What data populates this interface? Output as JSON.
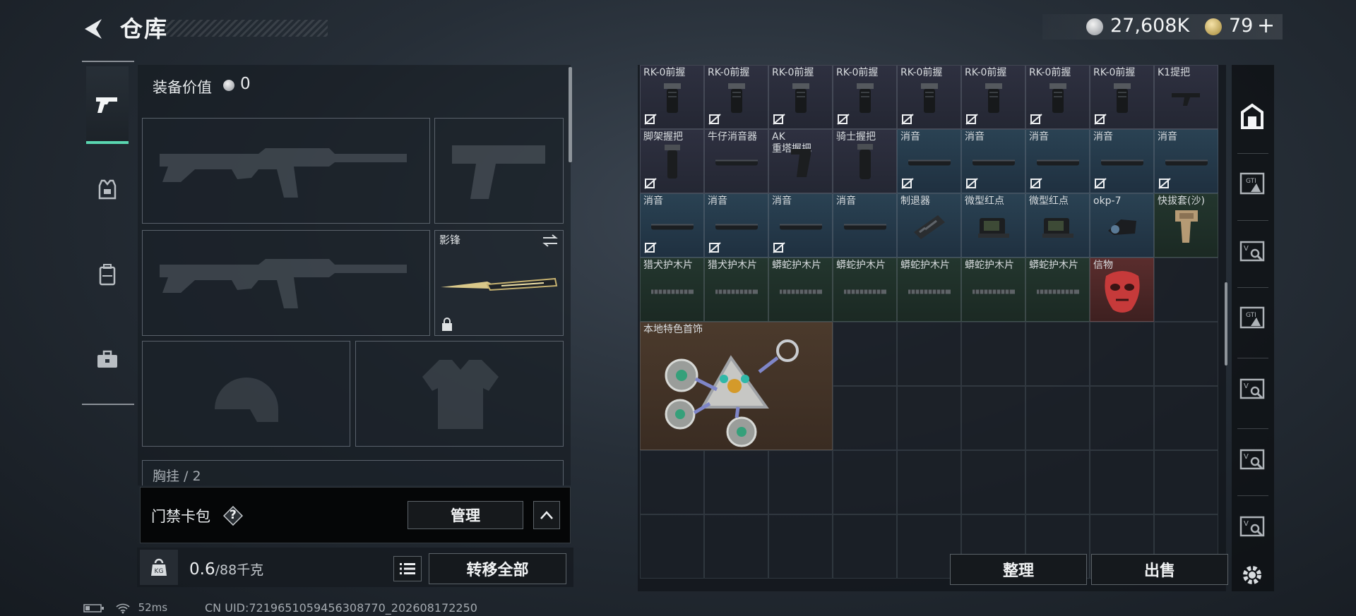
{
  "header": {
    "title": "仓库",
    "silver_value": "27,608K",
    "gold_value": "79",
    "plus": "+"
  },
  "left_nav": {
    "items": [
      {
        "name": "weapons",
        "icon": "pistol-icon",
        "active": true
      },
      {
        "name": "armor",
        "icon": "vest-icon",
        "active": false
      },
      {
        "name": "backpack",
        "icon": "backpack-icon",
        "active": false
      },
      {
        "name": "toolbox",
        "icon": "toolbox-icon",
        "active": false
      }
    ]
  },
  "loadout": {
    "equip_value_label": "装备价值",
    "equip_value": "0",
    "melee_name": "影锋",
    "chest_label": "胸挂 / 2",
    "keycard_label": "门禁卡包",
    "help": "?",
    "manage_label": "管理",
    "weight_value": "0.6",
    "weight_unit": "/88千克",
    "transfer_all_label": "转移全部"
  },
  "stash": {
    "items": [
      {
        "name": "RK-0前握",
        "rarity": "purple",
        "icon": "foregrip-icon",
        "uninsured": true
      },
      {
        "name": "RK-0前握",
        "rarity": "purple",
        "icon": "foregrip-icon",
        "uninsured": true
      },
      {
        "name": "RK-0前握",
        "rarity": "purple",
        "icon": "foregrip-icon",
        "uninsured": true
      },
      {
        "name": "RK-0前握",
        "rarity": "purple",
        "icon": "foregrip-icon",
        "uninsured": true
      },
      {
        "name": "RK-0前握",
        "rarity": "purple",
        "icon": "foregrip-icon",
        "uninsured": true
      },
      {
        "name": "RK-0前握",
        "rarity": "purple",
        "icon": "foregrip-icon",
        "uninsured": true
      },
      {
        "name": "RK-0前握",
        "rarity": "purple",
        "icon": "foregrip-icon",
        "uninsured": true
      },
      {
        "name": "RK-0前握",
        "rarity": "purple",
        "icon": "foregrip-icon",
        "uninsured": true
      },
      {
        "name": "K1提把",
        "rarity": "purple",
        "icon": "carry-handle-icon",
        "uninsured": false
      },
      {
        "name": "脚架握把",
        "rarity": "purple",
        "icon": "bipod-grip-icon",
        "uninsured": true
      },
      {
        "name": "牛仔消音器",
        "rarity": "purple",
        "icon": "suppressor-icon",
        "uninsured": false
      },
      {
        "name": "AK\n重塔握把",
        "rarity": "purple",
        "icon": "pistol-grip-icon",
        "uninsured": false
      },
      {
        "name": "骑士握把",
        "rarity": "purple",
        "icon": "vertical-grip-icon",
        "uninsured": false
      },
      {
        "name": "消音",
        "rarity": "blue",
        "icon": "suppressor-icon",
        "uninsured": true
      },
      {
        "name": "消音",
        "rarity": "blue",
        "icon": "suppressor-icon",
        "uninsured": true
      },
      {
        "name": "消音",
        "rarity": "blue",
        "icon": "suppressor-icon",
        "uninsured": true
      },
      {
        "name": "消音",
        "rarity": "blue",
        "icon": "suppressor-icon",
        "uninsured": true
      },
      {
        "name": "消音",
        "rarity": "blue",
        "icon": "suppressor-icon",
        "uninsured": true
      },
      {
        "name": "消音",
        "rarity": "blue",
        "icon": "suppressor-icon",
        "uninsured": true
      },
      {
        "name": "消音",
        "rarity": "blue",
        "icon": "suppressor-icon",
        "uninsured": true
      },
      {
        "name": "消音",
        "rarity": "blue",
        "icon": "suppressor-icon",
        "uninsured": true
      },
      {
        "name": "消音",
        "rarity": "blue",
        "icon": "suppressor-icon",
        "uninsured": false
      },
      {
        "name": "制退器",
        "rarity": "blue",
        "icon": "muzzle-brake-icon",
        "uninsured": false
      },
      {
        "name": "微型红点",
        "rarity": "blue",
        "icon": "red-dot-icon",
        "uninsured": false
      },
      {
        "name": "微型红点",
        "rarity": "blue",
        "icon": "red-dot-icon",
        "uninsured": false
      },
      {
        "name": "okp-7",
        "rarity": "blue",
        "icon": "okp7-sight-icon",
        "uninsured": false
      },
      {
        "name": "快拔套(沙)",
        "rarity": "green",
        "icon": "holster-icon",
        "uninsured": false
      },
      {
        "name": "猎犬护木片",
        "rarity": "green",
        "icon": "rail-cover-icon",
        "uninsured": false
      },
      {
        "name": "猎犬护木片",
        "rarity": "green",
        "icon": "rail-cover-icon",
        "uninsured": false
      },
      {
        "name": "蟒蛇护木片",
        "rarity": "green",
        "icon": "rail-cover-icon",
        "uninsured": false
      },
      {
        "name": "蟒蛇护木片",
        "rarity": "green",
        "icon": "rail-cover-icon",
        "uninsured": false
      },
      {
        "name": "蟒蛇护木片",
        "rarity": "green",
        "icon": "rail-cover-icon",
        "uninsured": false
      },
      {
        "name": "蟒蛇护木片",
        "rarity": "green",
        "icon": "rail-cover-icon",
        "uninsured": false
      },
      {
        "name": "蟒蛇护木片",
        "rarity": "green",
        "icon": "rail-cover-icon",
        "uninsured": false
      },
      {
        "name": "信物",
        "rarity": "red",
        "icon": "red-mask-icon",
        "uninsured": false
      },
      {
        "name": "本地特色首饰",
        "rarity": "orange",
        "icon": "jewelry-icon",
        "uninsured": false
      }
    ],
    "organize_label": "整理",
    "sell_label": "出售"
  },
  "right_sidebar": {
    "icons": [
      "stash-main-icon",
      "gti-case-icon",
      "vip-case-icon",
      "gti-case-icon",
      "vip-case-icon",
      "vip-case-icon",
      "vip-case-icon",
      "settings-icon"
    ]
  },
  "footer": {
    "ping": "52ms",
    "uid": "CN UID:7219651059456308770_202608172250"
  },
  "colors": {
    "accent": "#5ad6b0",
    "purple_rarity": "#2e3040",
    "blue_rarity": "#2a4253",
    "green_rarity": "#23362e",
    "red_rarity": "#5a2d2d",
    "orange_rarity": "#4b3a2c"
  }
}
